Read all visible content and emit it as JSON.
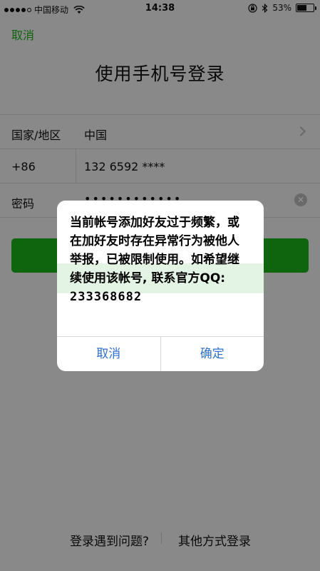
{
  "status_bar": {
    "carrier": "中国移动",
    "time": "14:38",
    "battery": "53%",
    "battery_level": 0.53,
    "icons": [
      "signal-dots",
      "wifi-icon",
      "lock-rotation-icon",
      "bluetooth-icon",
      "battery-icon"
    ]
  },
  "nav": {
    "cancel_label": "取消",
    "title": "使用手机号登录"
  },
  "form": {
    "country_label": "国家/地区",
    "country_value": "中国",
    "code_label": "+86",
    "phone_value": "132 6592 ****",
    "password_label": "密码",
    "password_mask": "••••••••••••"
  },
  "bottom_links": {
    "trouble": "登录遇到问题?",
    "other_methods": "其他方式登录"
  },
  "dialog": {
    "message_lines": [
      "当前帐号添加好友过于频繁，或",
      "在加好友时存在异常行为被他人",
      "举报，已被限制使用。如希望继",
      "续使用该帐号, 联系官方QQ:"
    ],
    "qq_number": "233368682",
    "cancel_label": "取消",
    "confirm_label": "确定",
    "button_color": "#2e6fcf"
  },
  "colors": {
    "accent": "#1aad19",
    "overlay": "rgba(0,0,0,0.42)"
  }
}
